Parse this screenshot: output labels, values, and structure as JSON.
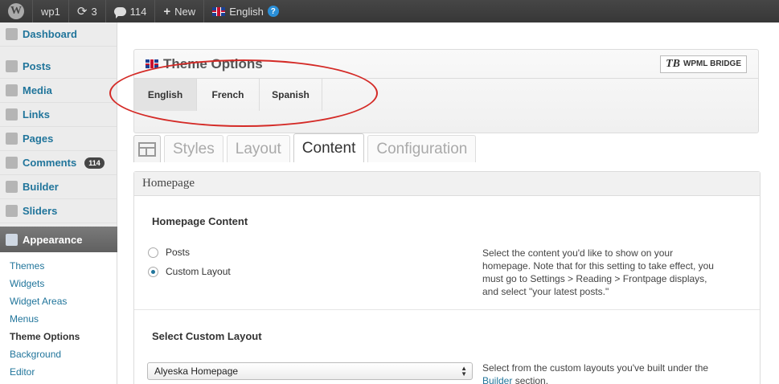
{
  "adminbar": {
    "site_name": "wp1",
    "updates_count": "3",
    "comments_count": "114",
    "new_label": "New",
    "language_label": "English"
  },
  "sidebar": {
    "items": [
      {
        "label": "Dashboard",
        "icon": "dashboard-icon"
      },
      {
        "label": "Posts",
        "icon": "pushpin-icon"
      },
      {
        "label": "Media",
        "icon": "media-icon"
      },
      {
        "label": "Links",
        "icon": "link-icon"
      },
      {
        "label": "Pages",
        "icon": "pages-icon"
      },
      {
        "label": "Comments",
        "icon": "comments-icon",
        "badge": "114"
      },
      {
        "label": "Builder",
        "icon": "builder-icon"
      },
      {
        "label": "Sliders",
        "icon": "sliders-icon"
      }
    ],
    "current": {
      "label": "Appearance",
      "icon": "appearance-icon"
    },
    "submenu": [
      "Themes",
      "Widgets",
      "Widget Areas",
      "Menus",
      "Theme Options",
      "Background",
      "Editor"
    ],
    "submenu_current": "Theme Options"
  },
  "options_box": {
    "title": "Theme Options",
    "logo_text": "WPML BRIDGE",
    "logo_mark": "TB",
    "languages": [
      "English",
      "French",
      "Spanish"
    ],
    "active_language": "English"
  },
  "nav_tabs": {
    "tabs": [
      "Styles",
      "Layout",
      "Content",
      "Configuration"
    ],
    "active": "Content"
  },
  "panel": {
    "title": "Homepage",
    "homepage_content": {
      "title": "Homepage Content",
      "options": [
        "Posts",
        "Custom Layout"
      ],
      "selected": "Custom Layout",
      "description": "Select the content you'd like to show on your homepage. Note that for this setting to take effect, you must go to Settings > Reading > Frontpage displays, and select \"your latest posts.\""
    },
    "custom_layout": {
      "title": "Select Custom Layout",
      "selected_value": "Alyeska Homepage",
      "description_pre": "Select from the custom layouts you've built under the",
      "description_link": "Builder",
      "description_post": "section."
    }
  },
  "colors": {
    "adminbar_bg": "#464646",
    "link": "#21759b",
    "annotation": "#d42a26"
  }
}
